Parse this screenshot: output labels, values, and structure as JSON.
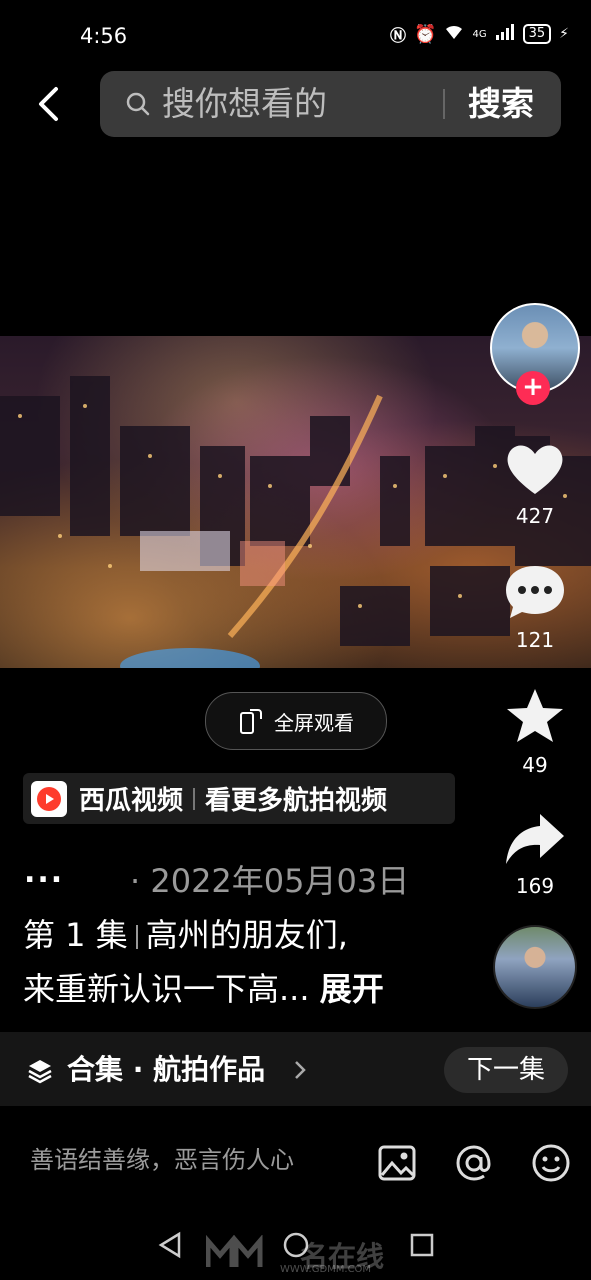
{
  "status_bar": {
    "time": "4:56",
    "network": "4G",
    "battery": "35"
  },
  "header": {
    "search_placeholder": "搜你想看的",
    "search_button": "搜索"
  },
  "rail": {
    "likes": "427",
    "comments": "121",
    "favorites": "49",
    "shares": "169"
  },
  "video": {
    "fullscreen_label": "全屏观看"
  },
  "xigua": {
    "name": "西瓜视频",
    "desc": "看更多航拍视频"
  },
  "meta": {
    "dots": "...",
    "date_prefix": "·",
    "date": "2022年05月03日"
  },
  "caption": {
    "episode": "第 1 集",
    "line1": "高州的朋友们,",
    "line2": "来重新认识一下高...",
    "expand": "展开"
  },
  "collection": {
    "label": "合集 · 航拍作品",
    "next": "下一集"
  },
  "comment_bar": {
    "placeholder": "善语结善缘，恶言伤人心"
  },
  "watermark": {
    "text": "名在线",
    "url": "WWW.GDMM.COM"
  }
}
